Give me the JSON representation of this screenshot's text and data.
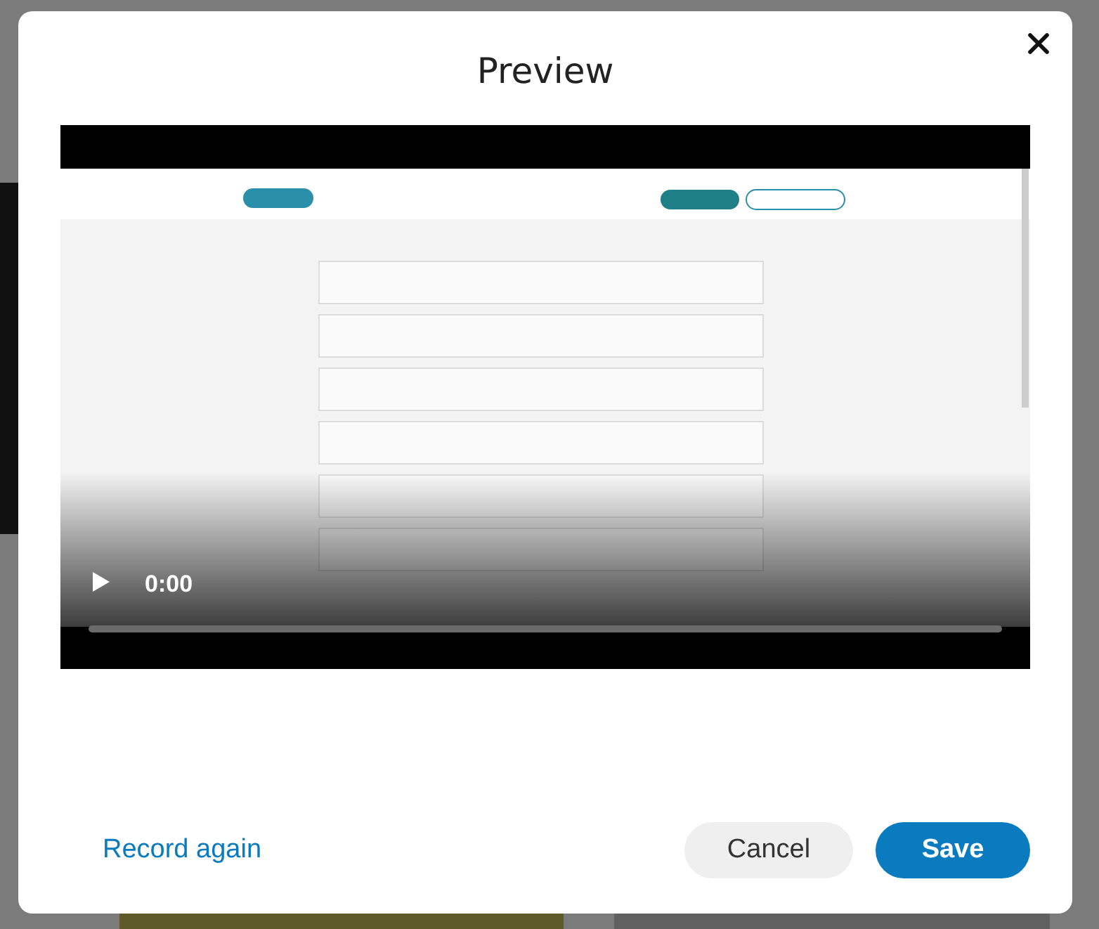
{
  "dialog": {
    "title": "Preview"
  },
  "video": {
    "kind": "picture",
    "time": "0:00"
  },
  "footer": {
    "link": "Record again",
    "buttons": [
      {
        "label": "Cancel",
        "kind": "secondary"
      },
      {
        "label": "Save",
        "kind": "primary"
      }
    ]
  }
}
